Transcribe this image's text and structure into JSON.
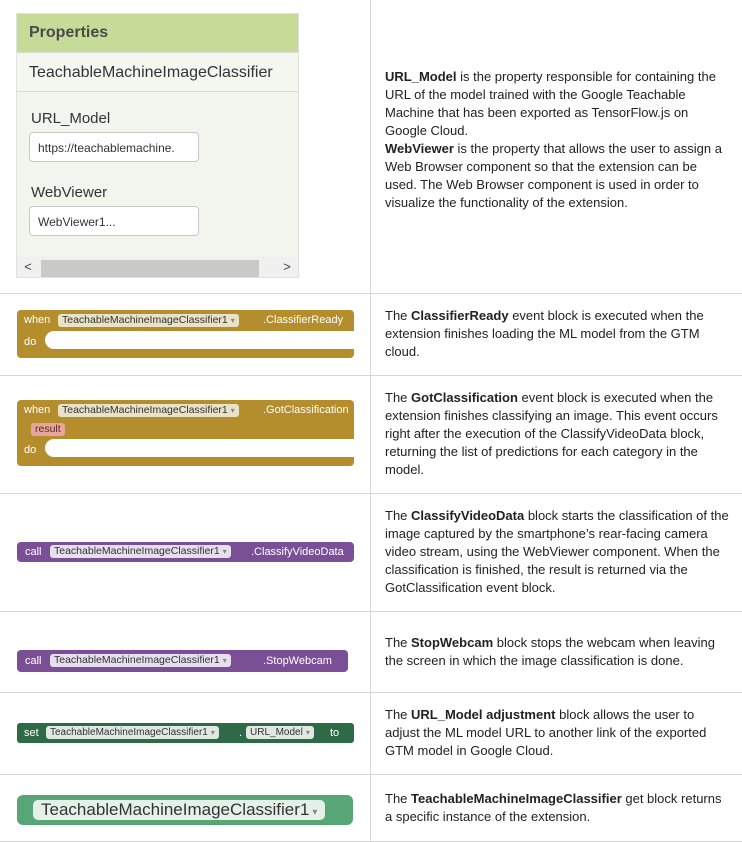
{
  "properties": {
    "header": "Properties",
    "component": "TeachableMachineImageClassifier",
    "url_label": "URL_Model",
    "url_value": "https://teachablemachine.",
    "webviewer_label": "WebViewer",
    "webviewer_value": "WebViewer1...",
    "scroll_left": "<",
    "scroll_right": ">"
  },
  "blocks": {
    "classifier_ready": {
      "when": "when",
      "component": "TeachableMachineImageClassifier1",
      "event": ".ClassifierReady",
      "do": "do"
    },
    "got_classification": {
      "when": "when",
      "component": "TeachableMachineImageClassifier1",
      "event": ".GotClassification",
      "param": "result",
      "do": "do"
    },
    "classify_video": {
      "call": "call",
      "component": "TeachableMachineImageClassifier1",
      "method": ".ClassifyVideoData"
    },
    "stop_webcam": {
      "call": "call",
      "component": "TeachableMachineImageClassifier1",
      "method": ".StopWebcam"
    },
    "set_url": {
      "set": "set",
      "component": "TeachableMachineImageClassifier1",
      "property": "URL_Model",
      "to": "to"
    },
    "getter": {
      "component": "TeachableMachineImageClassifier1"
    }
  },
  "dropdown_glyph": "▾",
  "rows": [
    {
      "bold1": "URL_Model",
      "text1": " is the property responsible for containing the URL of the model trained with the Google Teachable Machine that has been exported as TensorFlow.js on Google Cloud.",
      "bold2": "WebViewer",
      "text2": " is the property that allows the user to assign a Web Browser component so that the extension can be used. The Web Browser component is used in order to visualize the functionality of the extension."
    },
    {
      "pre": "The ",
      "bold": "ClassifierReady",
      "text": " event block is executed when the extension finishes loading the ML model from the GTM cloud."
    },
    {
      "pre": "The ",
      "bold": "GotClassification",
      "text": " event block is executed when the extension finishes classifying an image. This event occurs right after the execution of the ClassifyVideoData block, returning the list of predictions for each category in the model."
    },
    {
      "pre": "The ",
      "bold": "ClassifyVideoData",
      "text": " block starts the classification of the image captured by the smartphone’s rear-facing camera video stream, using the WebViewer component. When the classification is finished, the result is returned via the GotClassification event block."
    },
    {
      "pre": "The ",
      "bold": "StopWebcam",
      "text": " block stops the webcam when leaving the screen in which the image classification is done."
    },
    {
      "pre": "The ",
      "bold": "URL_Model adjustment",
      "text": " block allows the user to adjust the ML model URL to another link of the exported GTM model in Google Cloud."
    },
    {
      "pre": "The ",
      "bold": "TeachableMachineImageClassifier",
      "text": " get block returns a specific instance of the extension."
    }
  ],
  "colors": {
    "event": "#b48d2c",
    "procedure": "#7b4f96",
    "setter": "#2f6a47",
    "getter": "#58a675",
    "header": "#c7db98"
  }
}
